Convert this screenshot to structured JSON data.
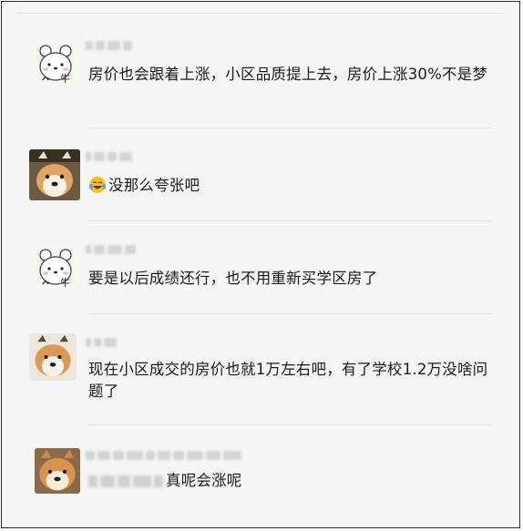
{
  "comments": [
    {
      "avatar": "bear-avatar-icon",
      "text": "房价也会跟着上涨，小区品质提上去，房价上涨30%不是梦"
    },
    {
      "avatar": "shiba-avatar-icon",
      "emoji": "laughing-crying-emoji-icon",
      "text": "没那么夸张吧"
    },
    {
      "avatar": "bear-avatar-icon",
      "text": "要是以后成绩还行，也不用重新买学区房了"
    },
    {
      "avatar": "shiba-avatar-icon",
      "text": "现在小区成交的房价也就1万左右吧，有了学校1.2万没啥问题了"
    },
    {
      "avatar": "shiba-avatar-icon",
      "text": "真呢会涨呢"
    }
  ],
  "colors": {
    "background": "#f5f5f5",
    "text": "#1a1a1a",
    "divider": "#e4e4e4"
  }
}
